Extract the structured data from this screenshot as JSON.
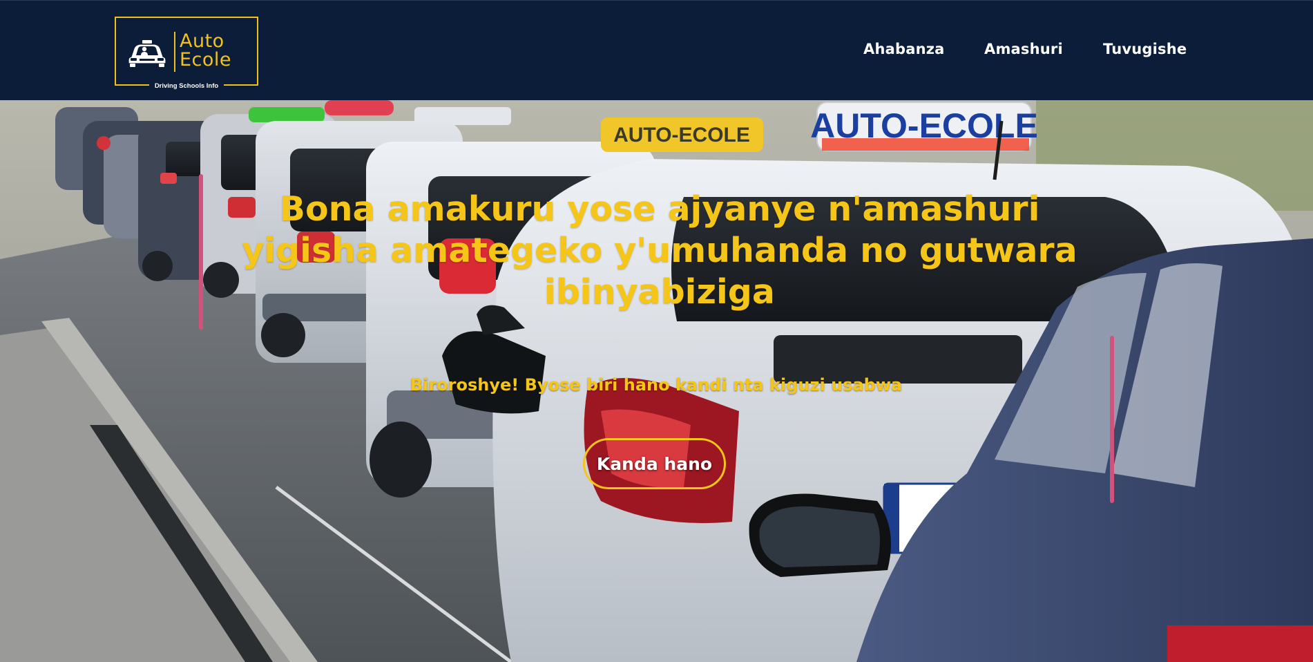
{
  "brand": {
    "line1": "Auto",
    "line2": "Ecole",
    "tagline": "Driving Schools Info",
    "icon": "car-icon",
    "color": "#f2c21b"
  },
  "nav": {
    "items": [
      {
        "label": "Ahabanza"
      },
      {
        "label": "Amashuri"
      },
      {
        "label": "Tuvugishe"
      }
    ]
  },
  "hero": {
    "title": "Bona amakuru yose ajyanye n'amashuri yigisha amategeko y'umuhanda no gutwara ibinyabiziga",
    "subtitle": "Biroroshye! Byose biri hano kandi nta kiguzi usabwa",
    "cta_label": "Kanda hano",
    "roof_sign_1": "AUTO-ECOLE",
    "roof_sign_2": "AUTO-ECOLE",
    "accent_color": "#d2527a",
    "text_color": "#f5c518"
  },
  "colors": {
    "header_bg": "#0b1d38",
    "nav_text": "#ffffff"
  }
}
